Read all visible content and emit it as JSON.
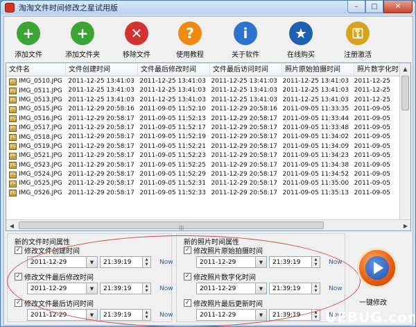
{
  "window": {
    "title": "淘淘文件时间修改之星试用版",
    "controls": {
      "minimize": "–",
      "maximize": "□",
      "close": "✕"
    }
  },
  "toolbar": [
    {
      "label": "添加文件",
      "icon": "add-file-icon",
      "color": "#3aa534",
      "glyph": "+"
    },
    {
      "label": "添加文件夹",
      "icon": "add-folder-icon",
      "color": "#3aa534",
      "glyph": "+"
    },
    {
      "label": "移除文件",
      "icon": "remove-file-icon",
      "color": "#d43131",
      "glyph": "✕"
    },
    {
      "label": "使用教程",
      "icon": "help-icon",
      "color": "#ee8a12",
      "glyph": "?"
    },
    {
      "label": "关于软件",
      "icon": "info-icon",
      "color": "#2b73cf",
      "glyph": "i"
    },
    {
      "label": "在线购买",
      "icon": "buy-online-icon",
      "color": "#1f5fb0",
      "glyph": "★"
    },
    {
      "label": "注册激活",
      "icon": "lock-icon",
      "color": "#d9a21c",
      "glyph": "⚿"
    }
  ],
  "grid": {
    "columns": [
      "文件名",
      "文件创建时间",
      "文件最后修改时间",
      "文件最后访问时间",
      "照片原始拍摄时间",
      "照片数字化时"
    ],
    "rows": [
      [
        "IMG_0510.JPG",
        "2011-12-25 13:41:03",
        "2011-12-25 13:41:03",
        "2011-12-25 13:41:03",
        "2011-12-25 13:41:03",
        "2011-12-25"
      ],
      [
        "IMG_0511.JPG",
        "2011-12-25 13:41:03",
        "2011-12-25 13:41:03",
        "2011-12-25 13:41:03",
        "2011-12-25 13:41:03",
        "2011-12-25"
      ],
      [
        "IMG_0513.JPG",
        "2011-12-25 13:41:03",
        "2011-12-25 13:41:03",
        "2011-12-25 13:41:03",
        "2011-12-25 13:41:03",
        "2011-12-25"
      ],
      [
        "IMG_0515.JPG",
        "2011-12-29 20:58:16",
        "2011-09-05 11:52:10",
        "2011-12-29 20:58:16",
        "2011-09-05 11:33:35",
        "2011-09-05"
      ],
      [
        "IMG_0516.JPG",
        "2011-12-29 20:58:17",
        "2011-09-05 11:52:13",
        "2011-12-29 20:58:17",
        "2011-09-05 11:33:44",
        "2011-09-05"
      ],
      [
        "IMG_0517.JPG",
        "2011-12-29 20:58:17",
        "2011-09-05 11:52:17",
        "2011-12-29 20:58:17",
        "2011-09-05 11:33:48",
        "2011-09-05"
      ],
      [
        "IMG_0518.JPG",
        "2011-12-29 20:58:17",
        "2011-09-05 11:52:19",
        "2011-12-29 20:58:17",
        "2011-09-05 11:34:02",
        "2011-09-05"
      ],
      [
        "IMG_0519.JPG",
        "2011-12-29 20:58:17",
        "2011-09-05 11:52:21",
        "2011-12-29 20:58:17",
        "2011-09-05 11:34:09",
        "2011-09-05"
      ],
      [
        "IMG_0521.JPG",
        "2011-12-29 20:58:17",
        "2011-09-05 11:52:23",
        "2011-12-29 20:58:17",
        "2011-09-05 11:34:23",
        "2011-09-05"
      ],
      [
        "IMG_0523.JPG",
        "2011-12-29 20:58:17",
        "2011-09-05 11:52:25",
        "2011-12-29 20:58:17",
        "2011-09-05 11:34:38",
        "2011-09-05"
      ],
      [
        "IMG_0524.JPG",
        "2011-12-29 20:58:17",
        "2011-09-05 11:52:29",
        "2011-12-29 20:58:17",
        "2011-09-05 11:34:52",
        "2011-09-05"
      ],
      [
        "IMG_0525.JPG",
        "2011-12-29 20:58:17",
        "2011-09-05 11:52:31",
        "2011-12-29 20:58:17",
        "2011-09-05 11:35:00",
        "2011-09-05"
      ],
      [
        "IMG_0526.JPG",
        "2011-12-29 20:58:17",
        "2011-09-05 11:52:33",
        "2011-12-29 20:58:17",
        "2011-09-05 11:35:13",
        "2011-09-05"
      ]
    ],
    "file_icon_text": "JPG"
  },
  "file_group": {
    "title": "新的文件时间属性",
    "items": [
      {
        "label": "修改文件创建时间",
        "checked": true,
        "date": "2011-12-29",
        "time": "21:39:19",
        "now": "Now"
      },
      {
        "label": "修改文件最后修改时间",
        "checked": true,
        "date": "2011-12-29",
        "time": "21:39:19",
        "now": "Now"
      },
      {
        "label": "修改文件最后访问时间",
        "checked": true,
        "date": "2011-12-29",
        "time": "21:39:19",
        "now": "Now"
      }
    ]
  },
  "photo_group": {
    "title": "新的照片时间属性",
    "items": [
      {
        "label": "修改照片原始拍摄时间",
        "checked": true,
        "date": "2011-12-29",
        "time": "21:39:19",
        "now": "Now"
      },
      {
        "label": "修改照片数字化时间",
        "checked": true,
        "date": "2011-12-29",
        "time": "21:39:19",
        "now": "Now"
      },
      {
        "label": "修改照片最后更新时间",
        "checked": true,
        "date": "2011-12-29",
        "time": "21:39:19",
        "now": "Now"
      }
    ]
  },
  "run_button": {
    "label": "一键修改"
  },
  "watermark": "UEBUG.com"
}
